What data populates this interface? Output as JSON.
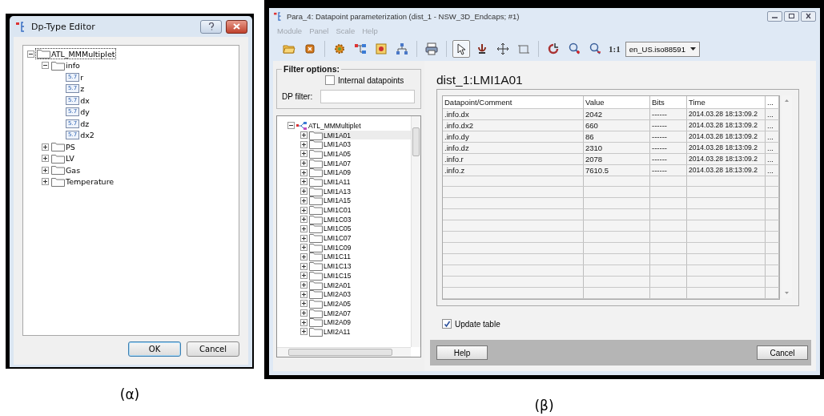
{
  "dialog_a": {
    "title": "Dp-Type Editor",
    "tree": [
      {
        "label": "ATL_MMMultiplet",
        "kind": "folder",
        "expanded": true,
        "selected": true,
        "children": [
          {
            "label": "info",
            "kind": "folder",
            "expanded": true,
            "selected": false,
            "children": [
              {
                "label": "r",
                "kind": "element",
                "type_label": "5.7",
                "selected": false
              },
              {
                "label": "z",
                "kind": "element",
                "type_label": "5.7",
                "selected": false
              },
              {
                "label": "dx",
                "kind": "element",
                "type_label": "5.7",
                "selected": false
              },
              {
                "label": "dy",
                "kind": "element",
                "type_label": "5.7",
                "selected": false
              },
              {
                "label": "dz",
                "kind": "element",
                "type_label": "5.7",
                "selected": false
              },
              {
                "label": "dx2",
                "kind": "element",
                "type_label": "5.7",
                "selected": false
              }
            ]
          },
          {
            "label": "PS",
            "kind": "folder",
            "expanded": false,
            "selected": false
          },
          {
            "label": "LV",
            "kind": "folder",
            "expanded": false,
            "selected": false
          },
          {
            "label": "Gas",
            "kind": "folder",
            "expanded": false,
            "selected": false
          },
          {
            "label": "Temperature",
            "kind": "folder",
            "expanded": false,
            "selected": false
          }
        ]
      }
    ],
    "buttons": [
      {
        "label": "OK",
        "default": true
      },
      {
        "label": "Cancel",
        "default": false
      }
    ]
  },
  "caption_a": "(α)",
  "window_b": {
    "title": "Para_4: Datapoint parameterization (dist_1 - NSW_3D_Endcaps; #1)",
    "menu": [
      {
        "label": "Module",
        "disabled": true
      },
      {
        "label": "Panel",
        "disabled": true
      },
      {
        "label": "Scale",
        "disabled": true
      },
      {
        "label": "Help",
        "disabled": true
      }
    ],
    "toolbar": {
      "tools": [
        {
          "selected": false
        },
        {
          "selected": false
        },
        {
          "selected": false
        },
        {
          "selected": false
        },
        {
          "selected": false
        },
        {
          "selected": false
        },
        {
          "selected": false
        },
        {
          "selected": true
        },
        {
          "selected": false
        },
        {
          "selected": false
        },
        {
          "selected": false
        },
        {
          "selected": false
        },
        {
          "selected": false
        },
        {
          "selected": false
        }
      ],
      "scale_button": "1:1",
      "locale": "en_US.iso88591"
    },
    "filter": {
      "title": "Filter options:",
      "internal": {
        "label": "Internal datapoints",
        "checked": false
      },
      "dp_filter_label": "DP filter:"
    },
    "dp_tree": [
      {
        "label": "ATL_MMMultiplet",
        "expanded": true,
        "selected": false,
        "children": [
          {
            "label": "LMI1A01",
            "expanded": false,
            "selected": true
          },
          {
            "label": "LMI1A03",
            "expanded": false,
            "selected": false
          },
          {
            "label": "LMI1A05",
            "expanded": false,
            "selected": false
          },
          {
            "label": "LMI1A07",
            "expanded": false,
            "selected": false
          },
          {
            "label": "LMI1A09",
            "expanded": false,
            "selected": false
          },
          {
            "label": "LMI1A11",
            "expanded": false,
            "selected": false
          },
          {
            "label": "LMI1A13",
            "expanded": false,
            "selected": false
          },
          {
            "label": "LMI1A15",
            "expanded": false,
            "selected": false
          },
          {
            "label": "LMI1C01",
            "expanded": false,
            "selected": false
          },
          {
            "label": "LMI1C03",
            "expanded": false,
            "selected": false
          },
          {
            "label": "LMI1C05",
            "expanded": false,
            "selected": false
          },
          {
            "label": "LMI1C07",
            "expanded": false,
            "selected": false
          },
          {
            "label": "LMI1C09",
            "expanded": false,
            "selected": false
          },
          {
            "label": "LMI1C11",
            "expanded": false,
            "selected": false
          },
          {
            "label": "LMI1C13",
            "expanded": false,
            "selected": false
          },
          {
            "label": "LMI1C15",
            "expanded": false,
            "selected": false
          },
          {
            "label": "LMI2A01",
            "expanded": false,
            "selected": false
          },
          {
            "label": "LMI2A03",
            "expanded": false,
            "selected": false
          },
          {
            "label": "LMI2A05",
            "expanded": false,
            "selected": false
          },
          {
            "label": "LMI2A07",
            "expanded": false,
            "selected": false
          },
          {
            "label": "LMI2A09",
            "expanded": false,
            "selected": false
          },
          {
            "label": "LMI2A11",
            "expanded": false,
            "selected": false
          }
        ]
      }
    ],
    "heading": "dist_1:LMI1A01",
    "table": {
      "columns": [
        "Datapoint/Comment",
        "Value",
        "Bits",
        "Time",
        "..."
      ],
      "rows": [
        [
          ".info.dx",
          "2042",
          "------",
          "2014.03.28 18:13:09.2",
          "..."
        ],
        [
          ".info.dx2",
          "660",
          "------",
          "2014.03.28 18:13:09.2",
          "..."
        ],
        [
          ".info.dy",
          "86",
          "------",
          "2014.03.28 18:13:09.2",
          "..."
        ],
        [
          ".info.dz",
          "2310",
          "------",
          "2014.03.28 18:13:09.2",
          "..."
        ],
        [
          ".info.r",
          "2078",
          "------",
          "2014.03.28 18:13:09.2",
          "..."
        ],
        [
          ".info.z",
          "7610.5",
          "------",
          "2014.03.28 18:13:09.2",
          "..."
        ]
      ]
    },
    "update_table": {
      "label": "Update table",
      "checked": true
    },
    "buttons": [
      {
        "label": "Help"
      },
      {
        "label": "Cancel"
      }
    ]
  },
  "caption_b": "(β)"
}
